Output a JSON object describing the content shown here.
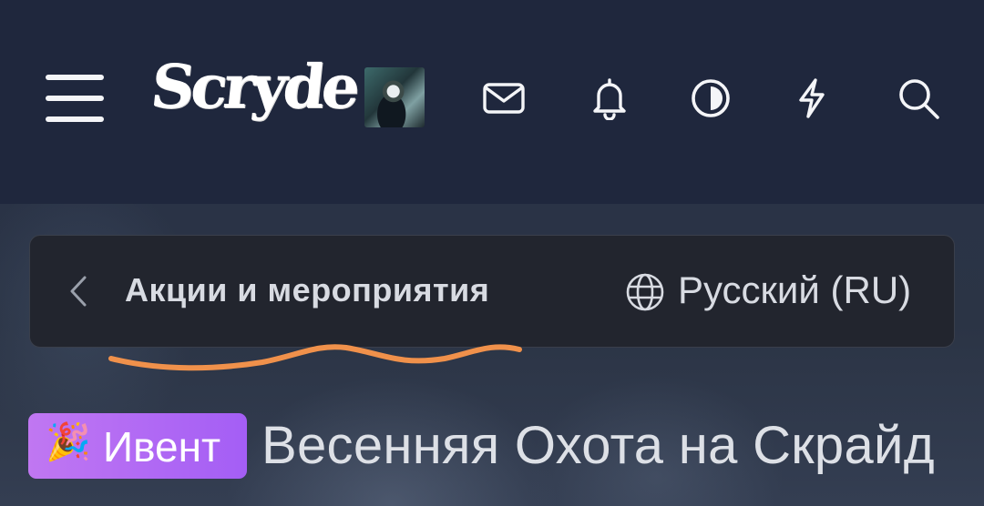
{
  "header": {
    "logo_text": "Scryde",
    "icons": [
      "menu-icon",
      "mail-icon",
      "bell-icon",
      "contrast-icon",
      "lightning-icon",
      "search-icon"
    ]
  },
  "breadcrumb": {
    "title": "Акции и мероприятия",
    "language": "Русский (RU)"
  },
  "thread": {
    "prefix_emoji": "🎉",
    "prefix_label": "Ивент",
    "title": "Весенняя Охота на Скрайд"
  },
  "colors": {
    "header_bg": "#1f273d",
    "badge": "#b06af4",
    "scribble": "#f0914b"
  }
}
